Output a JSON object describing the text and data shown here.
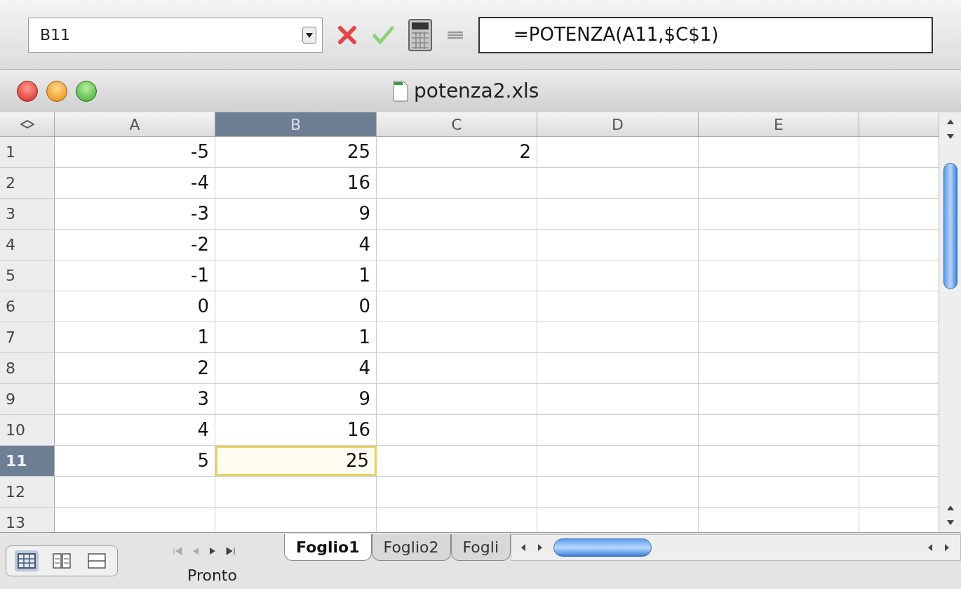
{
  "formula_bar": {
    "name_box": "B11",
    "formula": "=POTENZA(A11,$C$1)"
  },
  "window": {
    "title": "potenza2.xls"
  },
  "columns": [
    {
      "label": "A",
      "selected": false
    },
    {
      "label": "B",
      "selected": true
    },
    {
      "label": "C",
      "selected": false
    },
    {
      "label": "D",
      "selected": false
    },
    {
      "label": "E",
      "selected": false
    }
  ],
  "rows": [
    {
      "header": "1",
      "selected": false,
      "cells": [
        {
          "value": "-5",
          "selected": false
        },
        {
          "value": "25",
          "selected": false
        },
        {
          "value": "2",
          "selected": false
        }
      ]
    },
    {
      "header": "2",
      "selected": false,
      "cells": [
        {
          "value": "-4",
          "selected": false
        },
        {
          "value": "16",
          "selected": false
        }
      ]
    },
    {
      "header": "3",
      "selected": false,
      "cells": [
        {
          "value": "-3",
          "selected": false
        },
        {
          "value": "9",
          "selected": false
        }
      ]
    },
    {
      "header": "4",
      "selected": false,
      "cells": [
        {
          "value": "-2",
          "selected": false
        },
        {
          "value": "4",
          "selected": false
        }
      ]
    },
    {
      "header": "5",
      "selected": false,
      "cells": [
        {
          "value": "-1",
          "selected": false
        },
        {
          "value": "1",
          "selected": false
        }
      ]
    },
    {
      "header": "6",
      "selected": false,
      "cells": [
        {
          "value": "0",
          "selected": false
        },
        {
          "value": "0",
          "selected": false
        }
      ]
    },
    {
      "header": "7",
      "selected": false,
      "cells": [
        {
          "value": "1",
          "selected": false
        },
        {
          "value": "1",
          "selected": false
        }
      ]
    },
    {
      "header": "8",
      "selected": false,
      "cells": [
        {
          "value": "2",
          "selected": false
        },
        {
          "value": "4",
          "selected": false
        }
      ]
    },
    {
      "header": "9",
      "selected": false,
      "cells": [
        {
          "value": "3",
          "selected": false
        },
        {
          "value": "9",
          "selected": false
        }
      ]
    },
    {
      "header": "10",
      "selected": false,
      "cells": [
        {
          "value": "4",
          "selected": false
        },
        {
          "value": "16",
          "selected": false
        }
      ]
    },
    {
      "header": "11",
      "selected": true,
      "cells": [
        {
          "value": "5",
          "selected": false
        },
        {
          "value": "25",
          "selected": true
        }
      ]
    },
    {
      "header": "12",
      "selected": false
    },
    {
      "header": "13",
      "selected": false
    }
  ],
  "view_buttons": [
    {
      "kind": "normal",
      "selected": true
    },
    {
      "kind": "layout",
      "selected": false
    },
    {
      "kind": "split",
      "selected": false
    }
  ],
  "sheet_tabs": [
    {
      "label": "Foglio1",
      "selected": true
    },
    {
      "label": "Foglio2",
      "selected": false
    },
    {
      "label": "Fogli",
      "selected": false
    }
  ],
  "status_bar": {
    "text": "Pronto"
  }
}
